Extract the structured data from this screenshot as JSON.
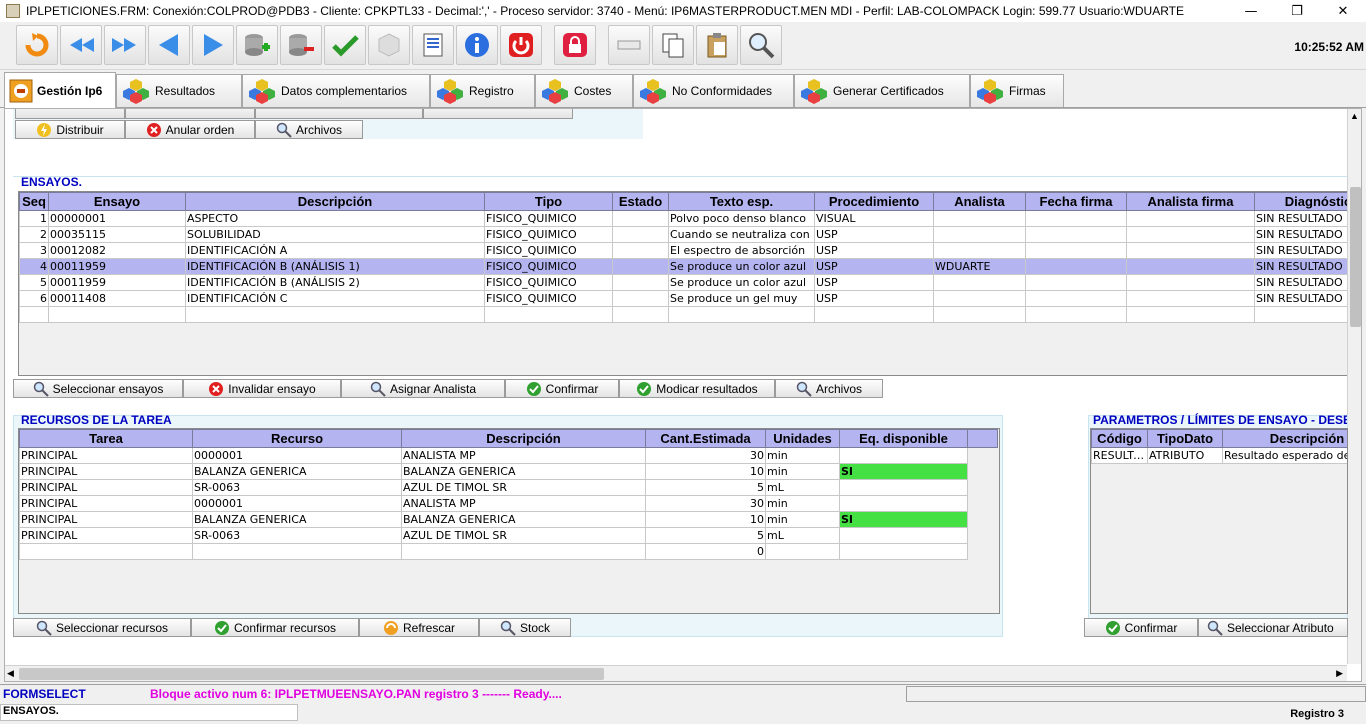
{
  "titlebar": {
    "title": "IPLPETICIONES.FRM:     Conexión:COLPROD@PDB3 - Cliente: CPKPTL33 - Decimal:',' - Proceso servidor: 3740 - Menú: IP6MASTERPRODUCT.MEN MDI - Perfil: LAB-COLOMPACK Login: 599.77       Usuario:WDUARTE",
    "minimize": "—",
    "restore": "❐",
    "close": "✕"
  },
  "clock": "10:25:52 AM",
  "toolbar_icons": [
    "exit-icon",
    "first-record-icon",
    "next-record-icon",
    "previous-icon",
    "forward-icon",
    "db-add-icon",
    "db-remove-icon",
    "confirm-check-icon",
    "cube-icon",
    "report-icon",
    "info-icon",
    "power-icon",
    "lock-icon",
    "blank-icon",
    "copy-icon",
    "paste-icon",
    "search-icon"
  ],
  "tabs": [
    {
      "label": "Gestión Ip6",
      "active": true
    },
    {
      "label": "Resultados"
    },
    {
      "label": "Datos complementarios"
    },
    {
      "label": "Registro"
    },
    {
      "label": "Costes"
    },
    {
      "label": "No Conformidades"
    },
    {
      "label": "Generar Certificados"
    },
    {
      "label": "Firmas"
    }
  ],
  "top_buttons": {
    "distribuir": "Distribuir",
    "anular": "Anular orden",
    "archivos": "Archivos"
  },
  "ensayos": {
    "label": "ENSAYOS.",
    "columns": [
      "Seq",
      "Ensayo",
      "Descripción",
      "Tipo",
      "Estado",
      "Texto esp.",
      "Procedimiento",
      "Analista",
      "Fecha firma",
      "Analista firma",
      "Diagnóstico"
    ],
    "rows": [
      [
        "1",
        "00000001",
        "ASPECTO",
        "FISICO_QUIMICO",
        "",
        "Polvo poco denso blanco",
        "VISUAL",
        "",
        "",
        "",
        "SIN RESULTADO"
      ],
      [
        "2",
        "00035115",
        "SOLUBILIDAD",
        "FISICO_QUIMICO",
        "",
        "Cuando se neutraliza con",
        "USP",
        "",
        "",
        "",
        "SIN RESULTADO"
      ],
      [
        "3",
        "00012082",
        "IDENTIFICACIÓN A",
        "FISICO_QUIMICO",
        "",
        "El espectro de absorción",
        "USP",
        "",
        "",
        "",
        "SIN RESULTADO"
      ],
      [
        "4",
        "00011959",
        "IDENTIFICACIÓN B (ANÁLISIS 1)",
        "FISICO_QUIMICO",
        "",
        "Se produce un color azul",
        "USP",
        "WDUARTE",
        "",
        "",
        "SIN RESULTADO"
      ],
      [
        "5",
        "00011959",
        "IDENTIFICACIÓN B (ANÁLISIS 2)",
        "FISICO_QUIMICO",
        "",
        "Se produce un color azul",
        "USP",
        "",
        "",
        "",
        "SIN RESULTADO"
      ],
      [
        "6",
        "00011408",
        "IDENTIFICACIÓN C",
        "FISICO_QUIMICO",
        "",
        "Se produce un gel muy",
        "USP",
        "",
        "",
        "",
        "SIN RESULTADO"
      ],
      [
        "",
        "",
        "",
        "",
        "",
        "",
        "",
        "",
        "",
        "",
        ""
      ]
    ],
    "buttons": {
      "seleccionar": "Seleccionar ensayos",
      "invalidar": "Invalidar ensayo",
      "asignar": "Asignar Analista",
      "confirmar": "Confirmar",
      "modicar": "Modicar resultados",
      "archivos": "Archivos"
    }
  },
  "recursos": {
    "label": "RECURSOS DE LA TAREA",
    "columns": [
      "Tarea",
      "Recurso",
      "Descripción",
      "Cant.Estimada",
      "Unidades",
      "Eq. disponible"
    ],
    "rows": [
      [
        "PRINCIPAL",
        "0000001",
        "ANALISTA MP",
        "30",
        "min",
        ""
      ],
      [
        "PRINCIPAL",
        "BALANZA GENERICA",
        "BALANZA GENERICA",
        "10",
        "min",
        "SI"
      ],
      [
        "PRINCIPAL",
        "SR-0063",
        "AZUL DE TIMOL SR",
        "5",
        "mL",
        ""
      ],
      [
        "PRINCIPAL",
        "0000001",
        "ANALISTA MP",
        "30",
        "min",
        ""
      ],
      [
        "PRINCIPAL",
        "BALANZA GENERICA",
        "BALANZA GENERICA",
        "10",
        "min",
        "SI"
      ],
      [
        "PRINCIPAL",
        "SR-0063",
        "AZUL DE TIMOL SR",
        "5",
        "mL",
        ""
      ],
      [
        "",
        "",
        "",
        "0",
        "",
        ""
      ]
    ],
    "buttons": {
      "seleccionar": "Seleccionar recursos",
      "confirmar": "Confirmar recursos",
      "refrescar": "Refrescar",
      "stock": "Stock"
    }
  },
  "parametros": {
    "label": "PARAMETROS / LÍMITES DE ENSAYO - DESBLOQ",
    "columns": [
      "Código",
      "TipoDato",
      "Descripción"
    ],
    "rows": [
      [
        "RESULTADO",
        "ATRIBUTO",
        "Resultado esperado de"
      ]
    ],
    "buttons": {
      "confirmar": "Confirmar",
      "seleccionar": "Seleccionar Atributo"
    }
  },
  "status": {
    "form": "FORMSELECT",
    "message": "Bloque activo num 6: IPLPETMUEENSAYO.PAN  registro 3 ------- Ready....",
    "block": "ENSAYOS.",
    "registro": "Registro 3"
  },
  "colors": {
    "header": "#b4b4f0",
    "section_label": "#0000c0",
    "status_msg": "#e000e0",
    "available": "#44e044"
  }
}
